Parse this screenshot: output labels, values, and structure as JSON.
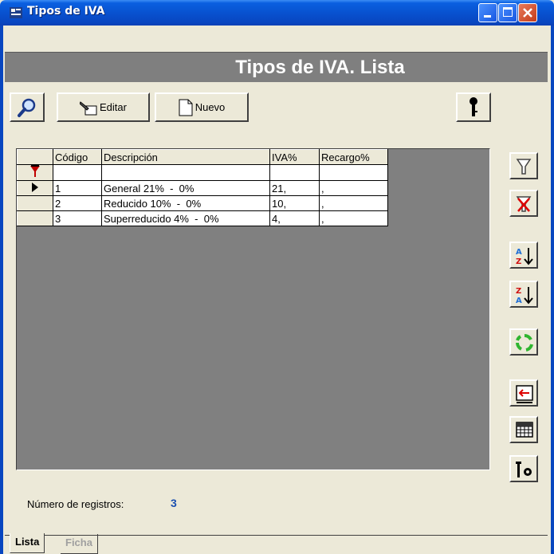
{
  "window": {
    "title": "Tipos de IVA",
    "colors": {
      "titlebar": "#0a5fe0",
      "banner": "#7f7f7f",
      "filter_row": "#f5c0c0",
      "count_value": "#1a4fb0"
    }
  },
  "banner": {
    "title": "Tipos de IVA. Lista"
  },
  "toolbar": {
    "search_icon": "magnifier-icon",
    "edit_label": "Editar",
    "new_label": "Nuevo",
    "key_icon": "key-icon"
  },
  "grid": {
    "columns": [
      "Código",
      "Descripción",
      "IVA%",
      "Recargo%"
    ],
    "rows": [
      {
        "codigo": "1",
        "descripcion": "General 21%  -  0%",
        "iva": "21,",
        "recargo": ","
      },
      {
        "codigo": "2",
        "descripcion": "Reducido 10%  -  0%",
        "iva": "10,",
        "recargo": ","
      },
      {
        "codigo": "3",
        "descripcion": "Superreducido 4%  -  0%",
        "iva": "4,",
        "recargo": ","
      }
    ],
    "current_row": 1
  },
  "side_tools": [
    "filter-icon",
    "clear-filter-icon",
    "sort-ascending-icon",
    "sort-descending-icon",
    "refresh-icon",
    "export-icon",
    "grid-icon",
    "settings-icon"
  ],
  "footer": {
    "count_label": "Número de registros:",
    "count_value": "3"
  },
  "tabs": [
    {
      "label": "Lista",
      "active": true
    },
    {
      "label": "Ficha",
      "active": false
    }
  ]
}
